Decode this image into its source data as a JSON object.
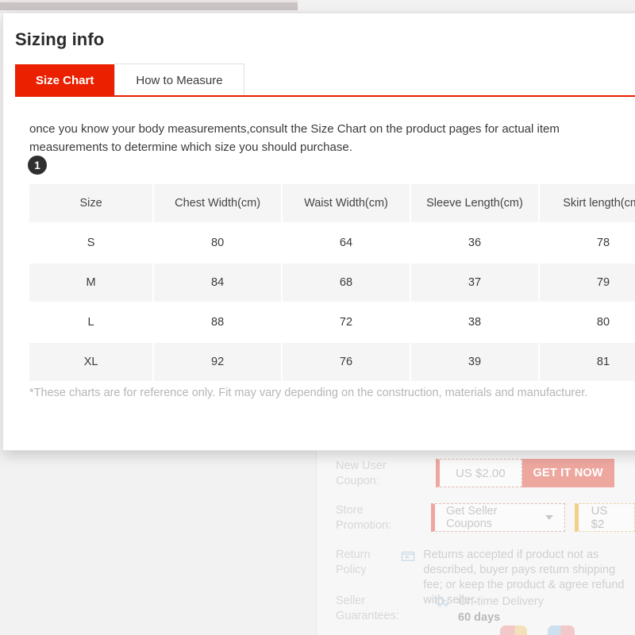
{
  "window": {
    "scrollbar": {
      "name": "horizontal-scrollbar"
    }
  },
  "modal": {
    "title": "Sizing info",
    "tabs": [
      {
        "label": "Size Chart",
        "active": true
      },
      {
        "label": "How to Measure",
        "active": false
      }
    ],
    "description": "once you know your body measurements,consult the Size Chart on the product pages for actual item measurements to determine which size you should purchase.",
    "step_badge": "1",
    "footnote": "*These charts are for reference only. Fit may vary depending on the construction, materials and manufacturer.",
    "accent_color": "#ea2000"
  },
  "chart_data": {
    "type": "table",
    "title": "Size Chart",
    "columns": [
      "Size",
      "Chest Width(cm)",
      "Waist Width(cm)",
      "Sleeve Length(cm)",
      "Skirt length(cm)"
    ],
    "rows": [
      [
        "S",
        "80",
        "64",
        "36",
        "78"
      ],
      [
        "M",
        "84",
        "68",
        "37",
        "79"
      ],
      [
        "L",
        "88",
        "72",
        "38",
        "80"
      ],
      [
        "XL",
        "92",
        "76",
        "39",
        "81"
      ]
    ]
  },
  "background_page": {
    "rows": [
      {
        "label": "New User Coupon:",
        "coupon_value": "US $2.00",
        "coupon_cta": "GET IT NOW"
      },
      {
        "label": "Store Promotion:",
        "promo_select": "Get Seller Coupons",
        "promo_second": "US $2"
      },
      {
        "label": "Return Policy",
        "icon": "return-box-icon",
        "text_line1": "Returns accepted if product not as described, buyer pays return shipping",
        "text_line2": "fee; or keep the product & agree refund with seller."
      },
      {
        "label": "Seller Guarantees:",
        "icon": "delivery-truck-icon",
        "text_line1": "On-time Delivery",
        "text_line2": "60 days"
      }
    ]
  }
}
